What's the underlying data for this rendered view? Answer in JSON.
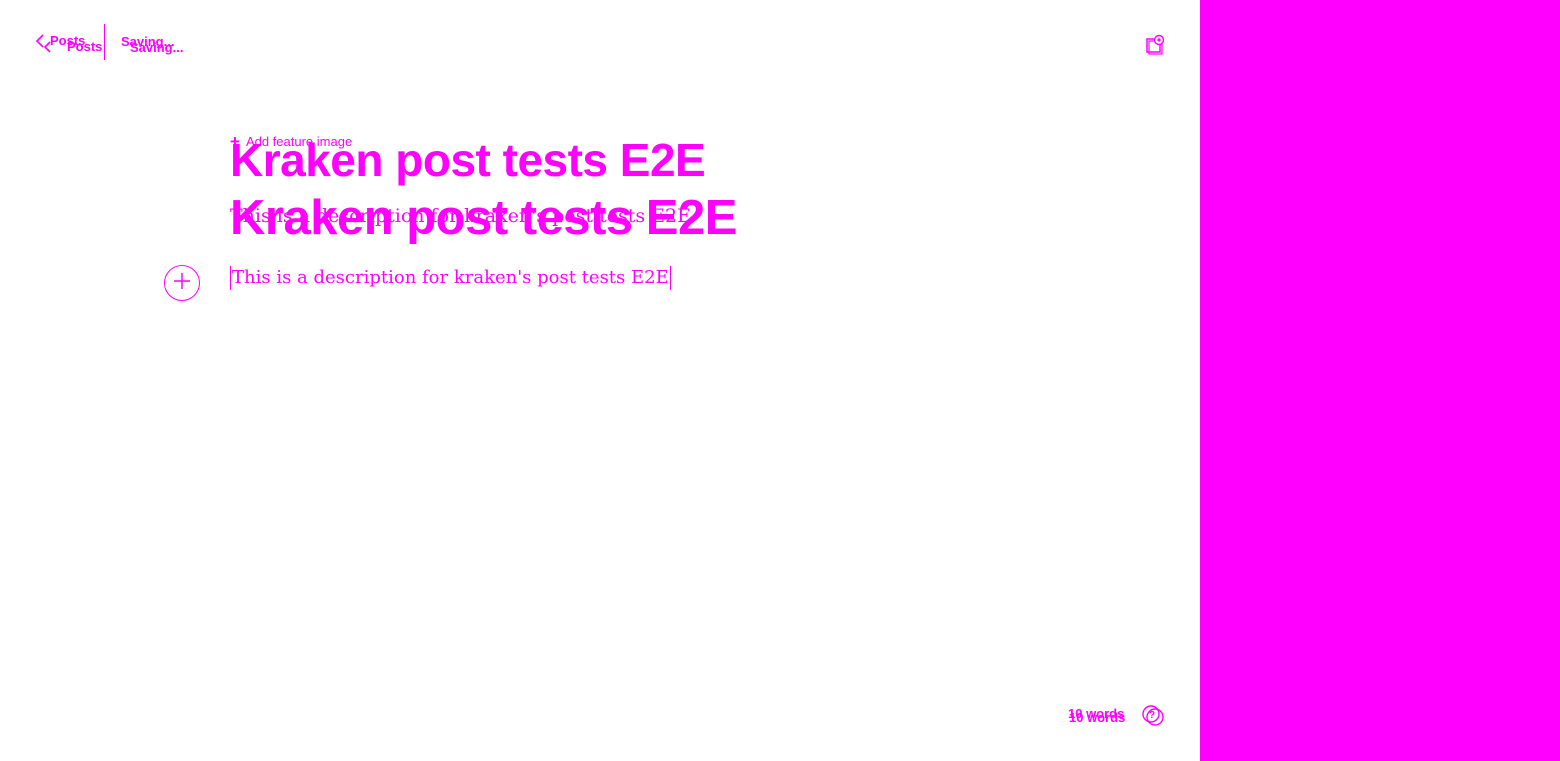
{
  "header": {
    "back_label": "Posts",
    "status": "Saving..."
  },
  "editor": {
    "feature_image_label": "Add feature image",
    "title": "Kraken post tests E2E",
    "excerpt": "This is a description for kraken's post tests E2E",
    "body": "This is a description for kraken's post tests E2E"
  },
  "footer": {
    "word_count": "10 words"
  },
  "icons": {
    "back": "chevron-left-icon",
    "settings": "settings-panel-icon",
    "add_card": "plus-circle-icon",
    "help": "help-icon"
  },
  "colors": {
    "accent": "#ff00ff",
    "background": "#ffffff"
  }
}
